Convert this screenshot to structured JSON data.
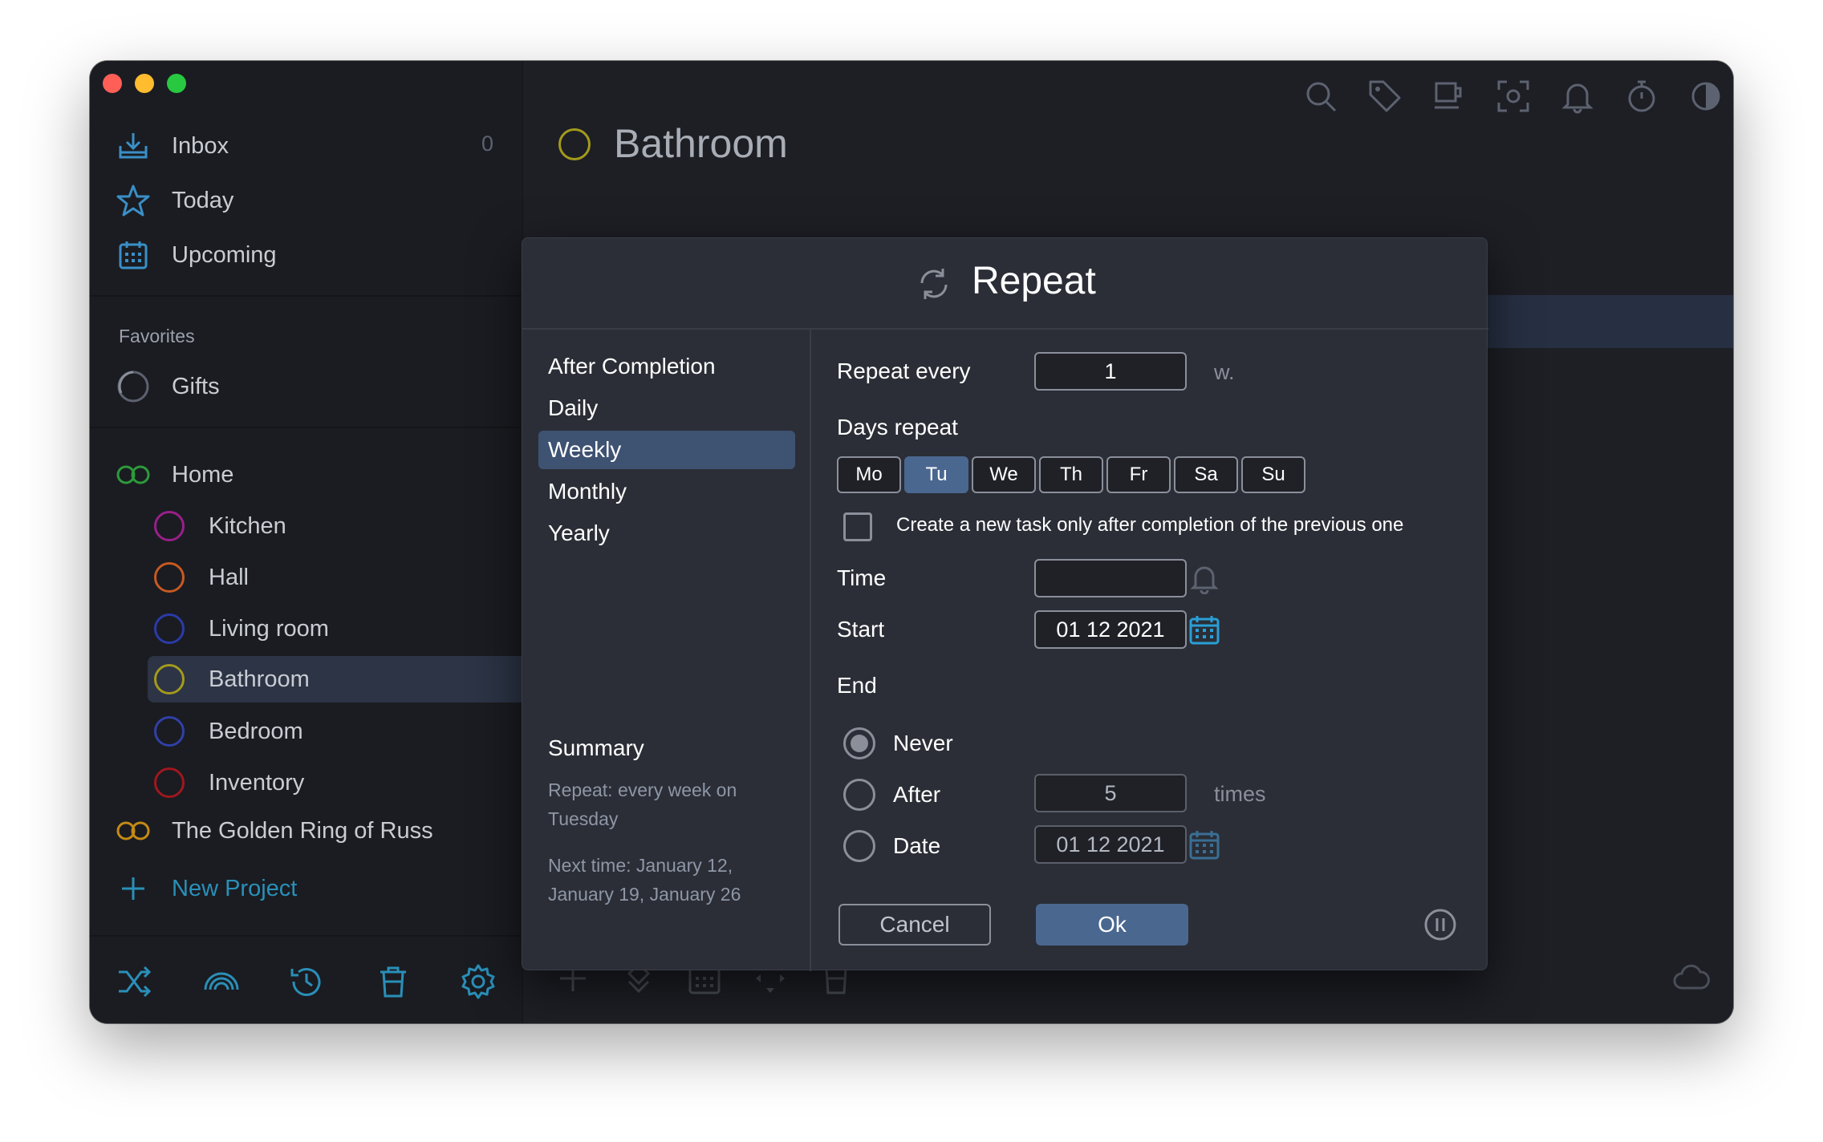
{
  "sidebar": {
    "nav": [
      {
        "label": "Inbox",
        "count": "0",
        "icon": "inbox-icon"
      },
      {
        "label": "Today",
        "icon": "star-icon"
      },
      {
        "label": "Upcoming",
        "icon": "calendar-icon"
      }
    ],
    "favorites_label": "Favorites",
    "favorites": [
      {
        "label": "Gifts",
        "icon": "progress-ring-icon"
      }
    ],
    "projects_group": {
      "label": "Home",
      "icon": "double-ring-icon",
      "color": "#2d9a3c"
    },
    "projects": [
      {
        "label": "Kitchen",
        "color": "#9a1f8a"
      },
      {
        "label": "Hall",
        "color": "#c75a21"
      },
      {
        "label": "Living room",
        "color": "#2b3ba8"
      },
      {
        "label": "Bathroom",
        "color": "#a39a1c"
      },
      {
        "label": "Bedroom",
        "color": "#3040a8"
      },
      {
        "label": "Inventory",
        "color": "#a0171e"
      }
    ],
    "group2": {
      "label": "The Golden Ring of Russ",
      "color": "#c58a14"
    },
    "new_project": "New Project"
  },
  "header": {
    "title": "Bathroom",
    "ring_color": "#a39a1c"
  },
  "dialog": {
    "title": "Repeat",
    "options": [
      "After Completion",
      "Daily",
      "Weekly",
      "Monthly",
      "Yearly"
    ],
    "selected_option": "Weekly",
    "summary_title": "Summary",
    "summary_repeat": "Repeat: every week on Tuesday",
    "summary_next": "Next time: January 12, January 19, January 26",
    "repeat_every_label": "Repeat every",
    "repeat_every_value": "1",
    "repeat_every_unit": "w.",
    "days_label": "Days repeat",
    "days": [
      "Mo",
      "Tu",
      "We",
      "Th",
      "Fr",
      "Sa",
      "Su"
    ],
    "selected_day": "Tu",
    "checkbox_label": "Create a new task only after completion of the previous one",
    "time_label": "Time",
    "time_value": "",
    "start_label": "Start",
    "start_value": "01 12 2021",
    "end_label": "End",
    "end_never": "Never",
    "end_after": "After",
    "end_after_value": "5",
    "end_after_unit": "times",
    "end_date": "Date",
    "end_date_value": "01 12 2021",
    "cancel": "Cancel",
    "ok": "Ok",
    "accent": "#4a6790"
  }
}
